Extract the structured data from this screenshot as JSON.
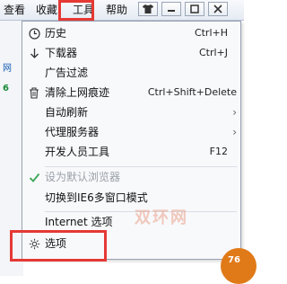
{
  "menubar": {
    "items": [
      "查看",
      "收藏",
      "工具",
      "帮助"
    ],
    "window_buttons": [
      "shirt",
      "minimize",
      "maximize",
      "close"
    ]
  },
  "background": {
    "fragment_1": "网",
    "fragment_2": "6"
  },
  "menu": {
    "items": [
      {
        "label": "历史",
        "shortcut": "Ctrl+H",
        "icon": "clock-icon"
      },
      {
        "label": "下载器",
        "shortcut": "Ctrl+J",
        "icon": "download-arrow-icon"
      },
      {
        "label": "广告过滤",
        "shortcut": "",
        "icon": ""
      },
      {
        "label": "清除上网痕迹",
        "shortcut": "Ctrl+Shift+Delete",
        "icon": "trash-icon"
      },
      {
        "label": "自动刷新",
        "shortcut": "",
        "icon": "",
        "submenu": true
      },
      {
        "label": "代理服务器",
        "shortcut": "",
        "icon": "",
        "submenu": true
      },
      {
        "label": "开发人员工具",
        "shortcut": "F12",
        "icon": ""
      },
      {
        "label": "设为默认浏览器",
        "shortcut": "",
        "icon": "checkmark-icon",
        "disabled": true
      },
      {
        "label": "切换到IE6多窗口模式",
        "shortcut": "",
        "icon": ""
      },
      {
        "label": "Internet 选项",
        "shortcut": "",
        "icon": ""
      },
      {
        "label": "选项",
        "shortcut": "",
        "icon": "gear-icon"
      }
    ]
  },
  "watermark": "双环网",
  "badge": "76",
  "colors": {
    "highlight_border": "#e53935",
    "menu_bg": "#f8f9fb",
    "check": "#3aa655"
  }
}
